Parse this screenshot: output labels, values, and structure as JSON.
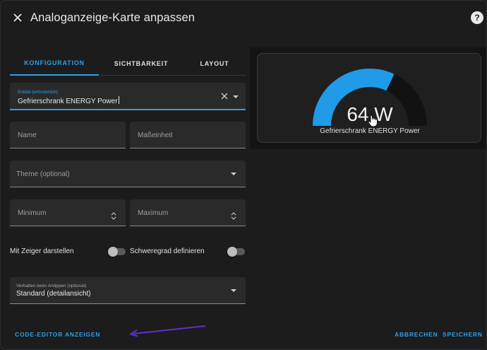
{
  "dialog": {
    "title": "Analoganzeige-Karte anpassen"
  },
  "tabs": [
    {
      "label": "KONFIGURATION",
      "active": true
    },
    {
      "label": "SICHTBARKEIT",
      "active": false
    },
    {
      "label": "LAYOUT",
      "active": false
    }
  ],
  "form": {
    "entity": {
      "label": "Entität (erforderlich)",
      "value": "Gefrierschrank ENERGY Power"
    },
    "name": {
      "label": "Name"
    },
    "unit": {
      "label": "Maßeinheit"
    },
    "theme": {
      "label": "Theme (optional)"
    },
    "minimum": {
      "label": "Minimum"
    },
    "maximum": {
      "label": "Maximum"
    },
    "needle_toggle": {
      "label": "Mit Zeiger darstellen",
      "on": false
    },
    "severity_toggle": {
      "label": "Schweregrad definieren",
      "on": false
    },
    "tap_action": {
      "label": "Verhalten beim Antippen (optional)",
      "value": "Standard (detailansicht)"
    }
  },
  "footer": {
    "code_editor": "CODE-EDITOR ANZEIGEN",
    "cancel": "ABBRECHEN",
    "save": "SPEICHERN"
  },
  "preview": {
    "value_text": "64 W",
    "entity_name": "Gefrierschrank ENERGY Power",
    "gauge_fraction": 0.64
  },
  "colors": {
    "accent": "#2aa0e8",
    "gauge_fill": "#1f9be8",
    "gauge_track": "#121212",
    "annotation_arrow": "#5b2fd6"
  }
}
